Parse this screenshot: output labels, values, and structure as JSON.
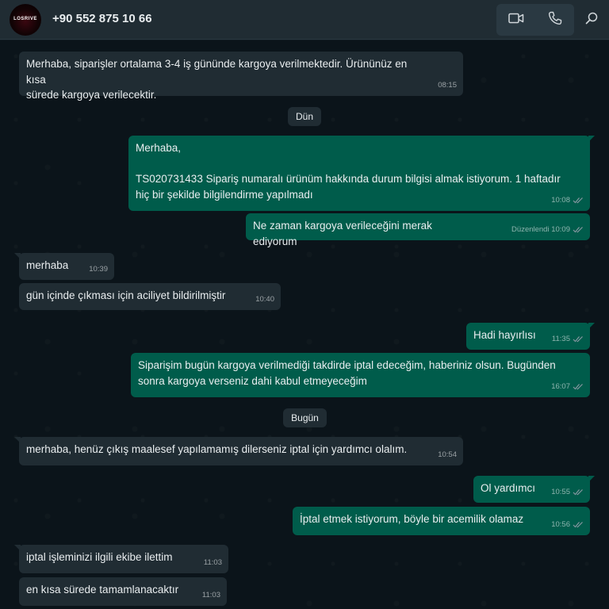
{
  "header": {
    "contact_name": "+90 552 875 10 66",
    "avatar_text": "LOSRIVE",
    "video_call_icon": "video-camera-icon",
    "voice_call_icon": "phone-icon",
    "search_icon": "search-icon"
  },
  "colors": {
    "header_bg": "#202c33",
    "chat_bg": "#0b141a",
    "incoming_bubble": "#202c33",
    "outgoing_bubble": "#005c4b",
    "tick_read": "#8696a0"
  },
  "messages": [
    {
      "text": "Merhaba, siparişler ortalama 3-4 iş gününde kargoya verilmektedir. Ürününüz en kısa\nsürede kargoya verilecektir.",
      "time": "08:15",
      "dir": "in"
    },
    {
      "text": "Merhaba,\n\nTS020731433 Sipariş numaralı ürünüm hakkında durum bilgisi almak istiyorum. 1 haftadır\nhiç bir şekilde bilgilendirme yapılmadı",
      "time": "10:08",
      "dir": "out"
    },
    {
      "text": "Ne zaman kargoya verileceğini merak ediyorum",
      "time": "Düzenlendi 10:09",
      "dir": "out"
    },
    {
      "text": "merhaba",
      "time": "10:39",
      "dir": "in"
    },
    {
      "text": "gün içinde çıkması için aciliyet bildirilmiştir",
      "time": "10:40",
      "dir": "in"
    },
    {
      "text": "Hadi hayırlısı",
      "time": "11:35",
      "dir": "out"
    },
    {
      "text": "Siparişim bugün kargoya verilmediği takdirde iptal edeceğim, haberiniz olsun. Bugünden\nsonra kargoya verseniz dahi kabul etmeyeceğim",
      "time": "16:07",
      "dir": "out"
    },
    {
      "text": "merhaba, henüz çıkış maalesef yapılamamış dilerseniz iptal için yardımcı olalım.",
      "time": "10:54",
      "dir": "in"
    },
    {
      "text": "Ol yardımcı",
      "time": "10:55",
      "dir": "out"
    },
    {
      "text": "İptal etmek istiyorum, böyle bir acemilik olamaz",
      "time": "10:56",
      "dir": "out"
    },
    {
      "text": "iptal işleminizi ilgili ekibe ilettim",
      "time": "11:03",
      "dir": "in"
    },
    {
      "text": "en kısa sürede tamamlanacaktır",
      "time": "11:03",
      "dir": "in"
    }
  ],
  "date_separators": [
    "Dün",
    "Bugün"
  ]
}
